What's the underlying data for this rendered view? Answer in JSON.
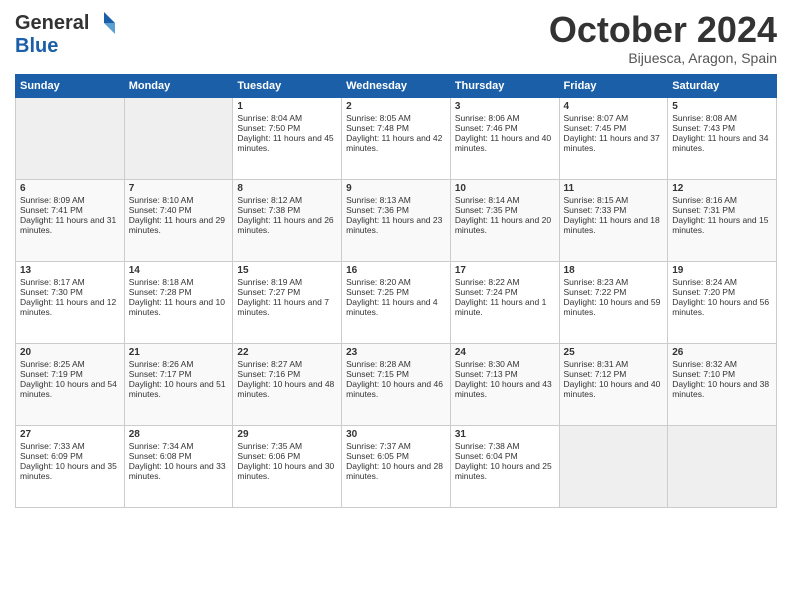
{
  "header": {
    "logo_line1": "General",
    "logo_line2": "Blue",
    "month": "October 2024",
    "location": "Bijuesca, Aragon, Spain"
  },
  "days_of_week": [
    "Sunday",
    "Monday",
    "Tuesday",
    "Wednesday",
    "Thursday",
    "Friday",
    "Saturday"
  ],
  "weeks": [
    [
      {
        "day": "",
        "empty": true
      },
      {
        "day": "",
        "empty": true
      },
      {
        "day": "1",
        "sunrise": "Sunrise: 8:04 AM",
        "sunset": "Sunset: 7:50 PM",
        "daylight": "Daylight: 11 hours and 45 minutes."
      },
      {
        "day": "2",
        "sunrise": "Sunrise: 8:05 AM",
        "sunset": "Sunset: 7:48 PM",
        "daylight": "Daylight: 11 hours and 42 minutes."
      },
      {
        "day": "3",
        "sunrise": "Sunrise: 8:06 AM",
        "sunset": "Sunset: 7:46 PM",
        "daylight": "Daylight: 11 hours and 40 minutes."
      },
      {
        "day": "4",
        "sunrise": "Sunrise: 8:07 AM",
        "sunset": "Sunset: 7:45 PM",
        "daylight": "Daylight: 11 hours and 37 minutes."
      },
      {
        "day": "5",
        "sunrise": "Sunrise: 8:08 AM",
        "sunset": "Sunset: 7:43 PM",
        "daylight": "Daylight: 11 hours and 34 minutes."
      }
    ],
    [
      {
        "day": "6",
        "sunrise": "Sunrise: 8:09 AM",
        "sunset": "Sunset: 7:41 PM",
        "daylight": "Daylight: 11 hours and 31 minutes."
      },
      {
        "day": "7",
        "sunrise": "Sunrise: 8:10 AM",
        "sunset": "Sunset: 7:40 PM",
        "daylight": "Daylight: 11 hours and 29 minutes."
      },
      {
        "day": "8",
        "sunrise": "Sunrise: 8:12 AM",
        "sunset": "Sunset: 7:38 PM",
        "daylight": "Daylight: 11 hours and 26 minutes."
      },
      {
        "day": "9",
        "sunrise": "Sunrise: 8:13 AM",
        "sunset": "Sunset: 7:36 PM",
        "daylight": "Daylight: 11 hours and 23 minutes."
      },
      {
        "day": "10",
        "sunrise": "Sunrise: 8:14 AM",
        "sunset": "Sunset: 7:35 PM",
        "daylight": "Daylight: 11 hours and 20 minutes."
      },
      {
        "day": "11",
        "sunrise": "Sunrise: 8:15 AM",
        "sunset": "Sunset: 7:33 PM",
        "daylight": "Daylight: 11 hours and 18 minutes."
      },
      {
        "day": "12",
        "sunrise": "Sunrise: 8:16 AM",
        "sunset": "Sunset: 7:31 PM",
        "daylight": "Daylight: 11 hours and 15 minutes."
      }
    ],
    [
      {
        "day": "13",
        "sunrise": "Sunrise: 8:17 AM",
        "sunset": "Sunset: 7:30 PM",
        "daylight": "Daylight: 11 hours and 12 minutes."
      },
      {
        "day": "14",
        "sunrise": "Sunrise: 8:18 AM",
        "sunset": "Sunset: 7:28 PM",
        "daylight": "Daylight: 11 hours and 10 minutes."
      },
      {
        "day": "15",
        "sunrise": "Sunrise: 8:19 AM",
        "sunset": "Sunset: 7:27 PM",
        "daylight": "Daylight: 11 hours and 7 minutes."
      },
      {
        "day": "16",
        "sunrise": "Sunrise: 8:20 AM",
        "sunset": "Sunset: 7:25 PM",
        "daylight": "Daylight: 11 hours and 4 minutes."
      },
      {
        "day": "17",
        "sunrise": "Sunrise: 8:22 AM",
        "sunset": "Sunset: 7:24 PM",
        "daylight": "Daylight: 11 hours and 1 minute."
      },
      {
        "day": "18",
        "sunrise": "Sunrise: 8:23 AM",
        "sunset": "Sunset: 7:22 PM",
        "daylight": "Daylight: 10 hours and 59 minutes."
      },
      {
        "day": "19",
        "sunrise": "Sunrise: 8:24 AM",
        "sunset": "Sunset: 7:20 PM",
        "daylight": "Daylight: 10 hours and 56 minutes."
      }
    ],
    [
      {
        "day": "20",
        "sunrise": "Sunrise: 8:25 AM",
        "sunset": "Sunset: 7:19 PM",
        "daylight": "Daylight: 10 hours and 54 minutes."
      },
      {
        "day": "21",
        "sunrise": "Sunrise: 8:26 AM",
        "sunset": "Sunset: 7:17 PM",
        "daylight": "Daylight: 10 hours and 51 minutes."
      },
      {
        "day": "22",
        "sunrise": "Sunrise: 8:27 AM",
        "sunset": "Sunset: 7:16 PM",
        "daylight": "Daylight: 10 hours and 48 minutes."
      },
      {
        "day": "23",
        "sunrise": "Sunrise: 8:28 AM",
        "sunset": "Sunset: 7:15 PM",
        "daylight": "Daylight: 10 hours and 46 minutes."
      },
      {
        "day": "24",
        "sunrise": "Sunrise: 8:30 AM",
        "sunset": "Sunset: 7:13 PM",
        "daylight": "Daylight: 10 hours and 43 minutes."
      },
      {
        "day": "25",
        "sunrise": "Sunrise: 8:31 AM",
        "sunset": "Sunset: 7:12 PM",
        "daylight": "Daylight: 10 hours and 40 minutes."
      },
      {
        "day": "26",
        "sunrise": "Sunrise: 8:32 AM",
        "sunset": "Sunset: 7:10 PM",
        "daylight": "Daylight: 10 hours and 38 minutes."
      }
    ],
    [
      {
        "day": "27",
        "sunrise": "Sunrise: 7:33 AM",
        "sunset": "Sunset: 6:09 PM",
        "daylight": "Daylight: 10 hours and 35 minutes."
      },
      {
        "day": "28",
        "sunrise": "Sunrise: 7:34 AM",
        "sunset": "Sunset: 6:08 PM",
        "daylight": "Daylight: 10 hours and 33 minutes."
      },
      {
        "day": "29",
        "sunrise": "Sunrise: 7:35 AM",
        "sunset": "Sunset: 6:06 PM",
        "daylight": "Daylight: 10 hours and 30 minutes."
      },
      {
        "day": "30",
        "sunrise": "Sunrise: 7:37 AM",
        "sunset": "Sunset: 6:05 PM",
        "daylight": "Daylight: 10 hours and 28 minutes."
      },
      {
        "day": "31",
        "sunrise": "Sunrise: 7:38 AM",
        "sunset": "Sunset: 6:04 PM",
        "daylight": "Daylight: 10 hours and 25 minutes."
      },
      {
        "day": "",
        "empty": true
      },
      {
        "day": "",
        "empty": true
      }
    ]
  ]
}
